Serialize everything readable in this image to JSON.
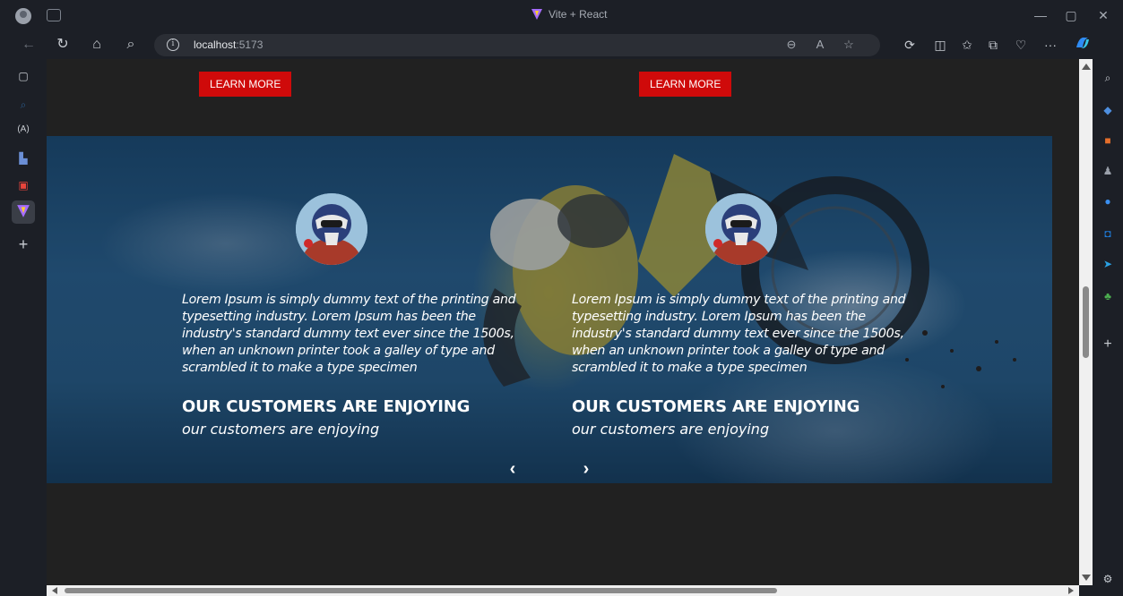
{
  "browser": {
    "tab_title": "Vite + React",
    "url_host": "localhost",
    "url_port": ":5173"
  },
  "page": {
    "learn_more_label": "LEARN MORE",
    "slides": [
      {
        "quote": "Lorem Ipsum is simply dummy text of the printing and typesetting industry. Lorem Ipsum has been the industry's standard dummy text ever since the 1500s, when an unknown printer took a galley of type and scrambled it to make a type specimen",
        "heading": "OUR CUSTOMERS ARE ENJOYING",
        "subheading": "our customers are enjoying"
      },
      {
        "quote": "Lorem Ipsum is simply dummy text of the printing and typesetting industry. Lorem Ipsum has been the industry's standard dummy text ever since the 1500s, when an unknown printer took a galley of type and scrambled it to make a type specimen",
        "heading": "OUR CUSTOMERS ARE ENJOYING",
        "subheading": "our customers are enjoying"
      }
    ],
    "prev_arrow": "‹",
    "next_arrow": "›"
  },
  "colors": {
    "button_red": "#cf0a0a",
    "page_background": "#212121",
    "browser_chrome": "#1c1f26"
  },
  "icons": {
    "left_sidebar": [
      "tab-actions-icon",
      "search-icon",
      "translate-icon",
      "collections-icon",
      "pdf-icon",
      "vite-app-icon",
      "add-icon"
    ],
    "right_sidebar": [
      "search-icon",
      "tag-icon",
      "toolbox-icon",
      "people-icon",
      "copilot-icon",
      "outlook-icon",
      "telegram-icon",
      "tree-icon",
      "add-icon",
      "settings-icon"
    ]
  }
}
